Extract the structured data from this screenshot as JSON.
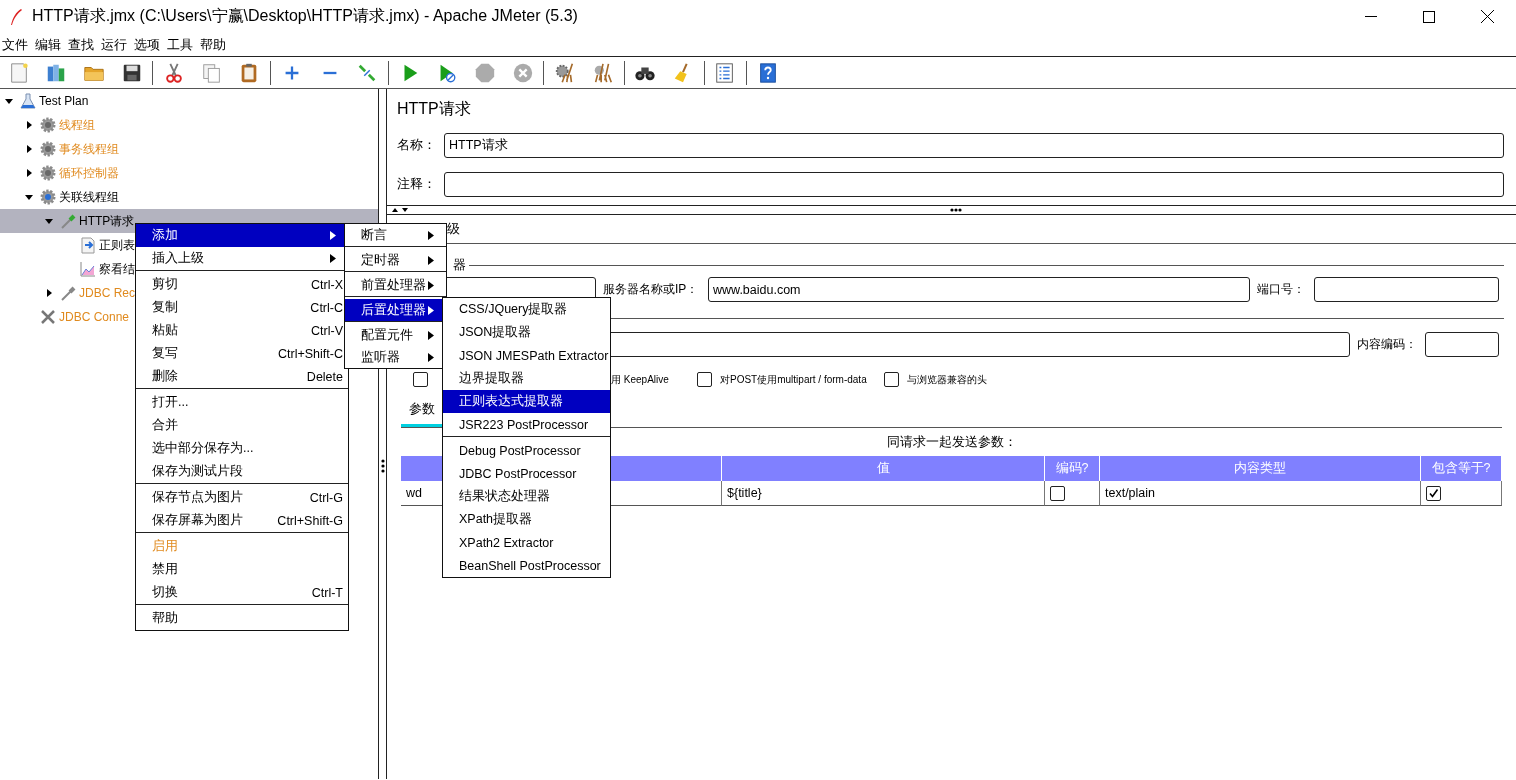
{
  "window": {
    "title": "HTTP请求.jmx (C:\\Users\\宁赢\\Desktop\\HTTP请求.jmx) - Apache JMeter (5.3)"
  },
  "menu_bar": [
    "文件",
    "编辑",
    "查找",
    "运行",
    "选项",
    "工具",
    "帮助"
  ],
  "toolbar": [
    {
      "kind": "new",
      "disabled": false
    },
    {
      "kind": "templates",
      "disabled": false
    },
    {
      "kind": "open",
      "disabled": false
    },
    {
      "kind": "save",
      "disabled": false
    },
    {
      "kind": "separator"
    },
    {
      "kind": "cut",
      "disabled": false
    },
    {
      "kind": "copy",
      "disabled": false
    },
    {
      "kind": "paste",
      "disabled": false
    },
    {
      "kind": "separator"
    },
    {
      "kind": "expand",
      "disabled": false
    },
    {
      "kind": "collapse",
      "disabled": false
    },
    {
      "kind": "toggle",
      "disabled": false
    },
    {
      "kind": "separator"
    },
    {
      "kind": "start",
      "disabled": false
    },
    {
      "kind": "start_no_timers",
      "disabled": false
    },
    {
      "kind": "stop",
      "disabled": true
    },
    {
      "kind": "shutdown",
      "disabled": true
    },
    {
      "kind": "separator"
    },
    {
      "kind": "clear",
      "disabled": false
    },
    {
      "kind": "clear_all",
      "disabled": false
    },
    {
      "kind": "separator"
    },
    {
      "kind": "search",
      "disabled": false
    },
    {
      "kind": "reset_search",
      "disabled": false
    },
    {
      "kind": "separator"
    },
    {
      "kind": "functions",
      "disabled": false
    },
    {
      "kind": "separator"
    },
    {
      "kind": "help",
      "disabled": false
    }
  ],
  "tree": [
    {
      "label": "Test Plan",
      "kind": "plan",
      "expanded": true,
      "disabled": false,
      "selected": false,
      "children": [
        {
          "label": "线程组",
          "kind": "thread-group",
          "expanded": false,
          "disabled": true,
          "selected": false
        },
        {
          "label": "事务线程组",
          "kind": "thread-group",
          "expanded": false,
          "disabled": true,
          "selected": false
        },
        {
          "label": "循环控制器",
          "kind": "thread-group",
          "expanded": false,
          "disabled": true,
          "selected": false
        },
        {
          "label": "关联线程组",
          "kind": "thread-group",
          "expanded": true,
          "disabled": false,
          "selected": false,
          "children": [
            {
              "label": "HTTP请求",
              "kind": "sampler",
              "expanded": true,
              "disabled": false,
              "selected": true,
              "children": [
                {
                  "label": "正则表",
                  "kind": "extractor",
                  "disabled": false,
                  "selected": false
                },
                {
                  "label": "察看结",
                  "kind": "listener",
                  "disabled": false,
                  "selected": false
                }
              ]
            },
            {
              "label": "JDBC Rec",
              "kind": "sampler",
              "expanded": false,
              "disabled": true,
              "selected": false
            }
          ]
        },
        {
          "label": "JDBC Conne",
          "kind": "config",
          "disabled": true,
          "selected": false
        }
      ]
    }
  ],
  "editor": {
    "title": "HTTP请求",
    "name_label": "名称：",
    "name_value": "HTTP请求",
    "comment_label": "注释：",
    "tab_fragment": "级",
    "server_group_fragment": "器",
    "server_label": "服务器名称或IP：",
    "server_value": "www.baidu.com",
    "port_label": "端口号：",
    "encoding_label": "内容编码：",
    "options": [
      {
        "checked": false
      },
      {
        "label": "用 KeepAlive"
      },
      {
        "label": "对POST使用multipart / form-data",
        "checked": false
      },
      {
        "label": "与浏览器兼容的头",
        "checked": false
      }
    ],
    "param_tabs": [
      {
        "label": "参数",
        "selected": true
      }
    ],
    "params_caption": "同请求一起发送参数：",
    "table": {
      "columns": [
        {
          "kind": "text"
        },
        {
          "label": "值",
          "kind": "text"
        },
        {
          "label": "编码?",
          "kind": "check"
        },
        {
          "label": "内容类型",
          "kind": "text"
        },
        {
          "label": "包含等于?",
          "kind": "check"
        }
      ],
      "rows": [
        {
          "cells": [
            {
              "text": "wd"
            },
            {
              "text": "${title}"
            },
            {
              "checked": false
            },
            {
              "text": "text/plain"
            },
            {
              "checked": true
            }
          ]
        }
      ]
    }
  },
  "context_menu": {
    "items": [
      {
        "kind": "item",
        "label": "添加",
        "submenu": true,
        "selected": true,
        "accent": false
      },
      {
        "kind": "item",
        "label": "插入上级",
        "submenu": true,
        "selected": false,
        "accent": false
      },
      {
        "kind": "separator"
      },
      {
        "kind": "item",
        "label": "剪切",
        "shortcut": "Ctrl-X",
        "submenu": false,
        "selected": false,
        "accent": false
      },
      {
        "kind": "item",
        "label": "复制",
        "shortcut": "Ctrl-C",
        "submenu": false,
        "selected": false,
        "accent": false
      },
      {
        "kind": "item",
        "label": "粘贴",
        "shortcut": "Ctrl-V",
        "submenu": false,
        "selected": false,
        "accent": false
      },
      {
        "kind": "item",
        "label": "复写",
        "shortcut": "Ctrl+Shift-C",
        "submenu": false,
        "selected": false,
        "accent": false
      },
      {
        "kind": "item",
        "label": "删除",
        "shortcut": "Delete",
        "submenu": false,
        "selected": false,
        "accent": false
      },
      {
        "kind": "separator"
      },
      {
        "kind": "item",
        "label": "打开...",
        "submenu": false,
        "selected": false,
        "accent": false
      },
      {
        "kind": "item",
        "label": "合并",
        "submenu": false,
        "selected": false,
        "accent": false
      },
      {
        "kind": "item",
        "label": "选中部分保存为...",
        "submenu": false,
        "selected": false,
        "accent": false
      },
      {
        "kind": "item",
        "label": "保存为测试片段",
        "submenu": false,
        "selected": false,
        "accent": false
      },
      {
        "kind": "separator"
      },
      {
        "kind": "item",
        "label": "保存节点为图片",
        "shortcut": "Ctrl-G",
        "submenu": false,
        "selected": false,
        "accent": false
      },
      {
        "kind": "item",
        "label": "保存屏幕为图片",
        "shortcut": "Ctrl+Shift-G",
        "submenu": false,
        "selected": false,
        "accent": false
      },
      {
        "kind": "separator"
      },
      {
        "kind": "item",
        "label": "启用",
        "submenu": false,
        "selected": false,
        "accent": true
      },
      {
        "kind": "item",
        "label": "禁用",
        "submenu": false,
        "selected": false,
        "accent": false
      },
      {
        "kind": "item",
        "label": "切换",
        "shortcut": "Ctrl-T",
        "submenu": false,
        "selected": false,
        "accent": false
      },
      {
        "kind": "separator"
      },
      {
        "kind": "item",
        "label": "帮助",
        "submenu": false,
        "selected": false,
        "accent": false
      }
    ]
  },
  "add_submenu": {
    "items": [
      {
        "kind": "item",
        "label": "断言",
        "submenu": true,
        "selected": false
      },
      {
        "kind": "separator"
      },
      {
        "kind": "item",
        "label": "定时器",
        "submenu": true,
        "selected": false
      },
      {
        "kind": "separator"
      },
      {
        "kind": "item",
        "label": "前置处理器",
        "submenu": true,
        "selected": false
      },
      {
        "kind": "separator"
      },
      {
        "kind": "item",
        "label": "后置处理器",
        "submenu": true,
        "selected": true
      },
      {
        "kind": "separator"
      },
      {
        "kind": "item",
        "label": "配置元件",
        "submenu": true,
        "selected": false
      },
      {
        "kind": "item",
        "label": "监听器",
        "submenu": true,
        "selected": false
      }
    ]
  },
  "postprocessor_submenu": {
    "items": [
      {
        "kind": "item",
        "label": "CSS/JQuery提取器",
        "submenu": false,
        "selected": false
      },
      {
        "kind": "item",
        "label": "JSON提取器",
        "submenu": false,
        "selected": false
      },
      {
        "kind": "item",
        "label": "JSON JMESPath Extractor",
        "submenu": false,
        "selected": false
      },
      {
        "kind": "item",
        "label": "边界提取器",
        "submenu": false,
        "selected": false
      },
      {
        "kind": "item",
        "label": "正则表达式提取器",
        "submenu": false,
        "selected": true
      },
      {
        "kind": "item",
        "label": "JSR223 PostProcessor",
        "submenu": false,
        "selected": false
      },
      {
        "kind": "separator"
      },
      {
        "kind": "item",
        "label": "Debug PostProcessor",
        "submenu": false,
        "selected": false
      },
      {
        "kind": "item",
        "label": "JDBC PostProcessor",
        "submenu": false,
        "selected": false
      },
      {
        "kind": "item",
        "label": "结果状态处理器",
        "submenu": false,
        "selected": false
      },
      {
        "kind": "item",
        "label": "XPath提取器",
        "submenu": false,
        "selected": false
      },
      {
        "kind": "item",
        "label": "XPath2 Extractor",
        "submenu": false,
        "selected": false
      },
      {
        "kind": "item",
        "label": "BeanShell PostProcessor",
        "submenu": false,
        "selected": false
      }
    ]
  }
}
